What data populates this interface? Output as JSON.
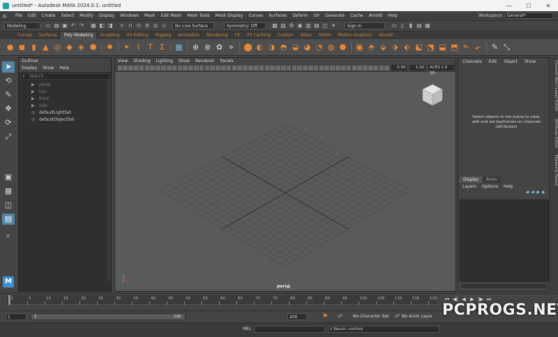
{
  "window": {
    "title": "untitled* - Autodesk MAYA 2024.0.1: untitled",
    "minimize": "—",
    "maximize": "☐",
    "close": "✕"
  },
  "menubar": {
    "items": [
      "File",
      "Edit",
      "Create",
      "Select",
      "Modify",
      "Display",
      "Windows",
      "Mesh",
      "Edit Mesh",
      "Mesh Tools",
      "Mesh Display",
      "Curves",
      "Surfaces",
      "Deform",
      "UV",
      "Generate",
      "Cache",
      "Arnold",
      "Help"
    ],
    "workspace_label": "Workspace:",
    "workspace_value": "General*"
  },
  "statusline": {
    "menuset": "Modeling",
    "live_surface": "No Live Surface",
    "symmetry": "Symmetry: Off",
    "sign_in": "Sign In"
  },
  "shelf": {
    "tabs": [
      "Curves",
      "Surfaces",
      "Poly Modeling",
      "Sculpting",
      "UV Editing",
      "Rigging",
      "Animation",
      "Rendering",
      "FX",
      "FX Caching",
      "Custom",
      "XGen",
      "MASH",
      "Motion Graphics",
      "Arnold"
    ],
    "active_tab": "Poly Modeling"
  },
  "outliner": {
    "title": "Outliner",
    "menu": [
      "Display",
      "Show",
      "Help"
    ],
    "search_placeholder": "Search...",
    "items": [
      {
        "label": "persp",
        "type": "camera"
      },
      {
        "label": "top",
        "type": "camera"
      },
      {
        "label": "front",
        "type": "camera"
      },
      {
        "label": "side",
        "type": "camera"
      },
      {
        "label": "defaultLightSet",
        "type": "set"
      },
      {
        "label": "defaultObjectSet",
        "type": "set"
      }
    ]
  },
  "viewport": {
    "menu": [
      "View",
      "Shading",
      "Lighting",
      "Show",
      "Renderer",
      "Panels"
    ],
    "field_1": "0.00",
    "field_2": "1.00",
    "color_space": "ACES 1.0 SD",
    "camera_label": "persp"
  },
  "channelbox": {
    "menu": [
      "Channels",
      "Edit",
      "Object",
      "Show"
    ],
    "message_line1": "Select objects in the scene to view,",
    "message_line2": "edit and set keyframes on channels",
    "message_line3": "(attributes)",
    "layer_tabs": [
      "Display",
      "Anim"
    ],
    "layer_menu": [
      "Layers",
      "Options",
      "Help"
    ]
  },
  "side_tabs": [
    "Channel Box / Layer Editor",
    "Attribute Editor",
    "Modeling Toolkit"
  ],
  "timeslider": {
    "ticks": [
      "1",
      "5",
      "10",
      "15",
      "20",
      "25",
      "30",
      "35",
      "40",
      "45",
      "50",
      "55",
      "60",
      "65",
      "70",
      "75",
      "80",
      "85",
      "90",
      "95",
      "100",
      "105",
      "110",
      "115",
      "120"
    ]
  },
  "rangeslider": {
    "start_field": "1",
    "range_start": "1",
    "range_end": "120",
    "end_field": "200",
    "character_set": "No Character Set",
    "anim_layer": "No Anim Layer"
  },
  "commandline": {
    "lang": "MEL",
    "result": "// Result: untitled"
  },
  "watermark": "PCPROGS.NET"
}
